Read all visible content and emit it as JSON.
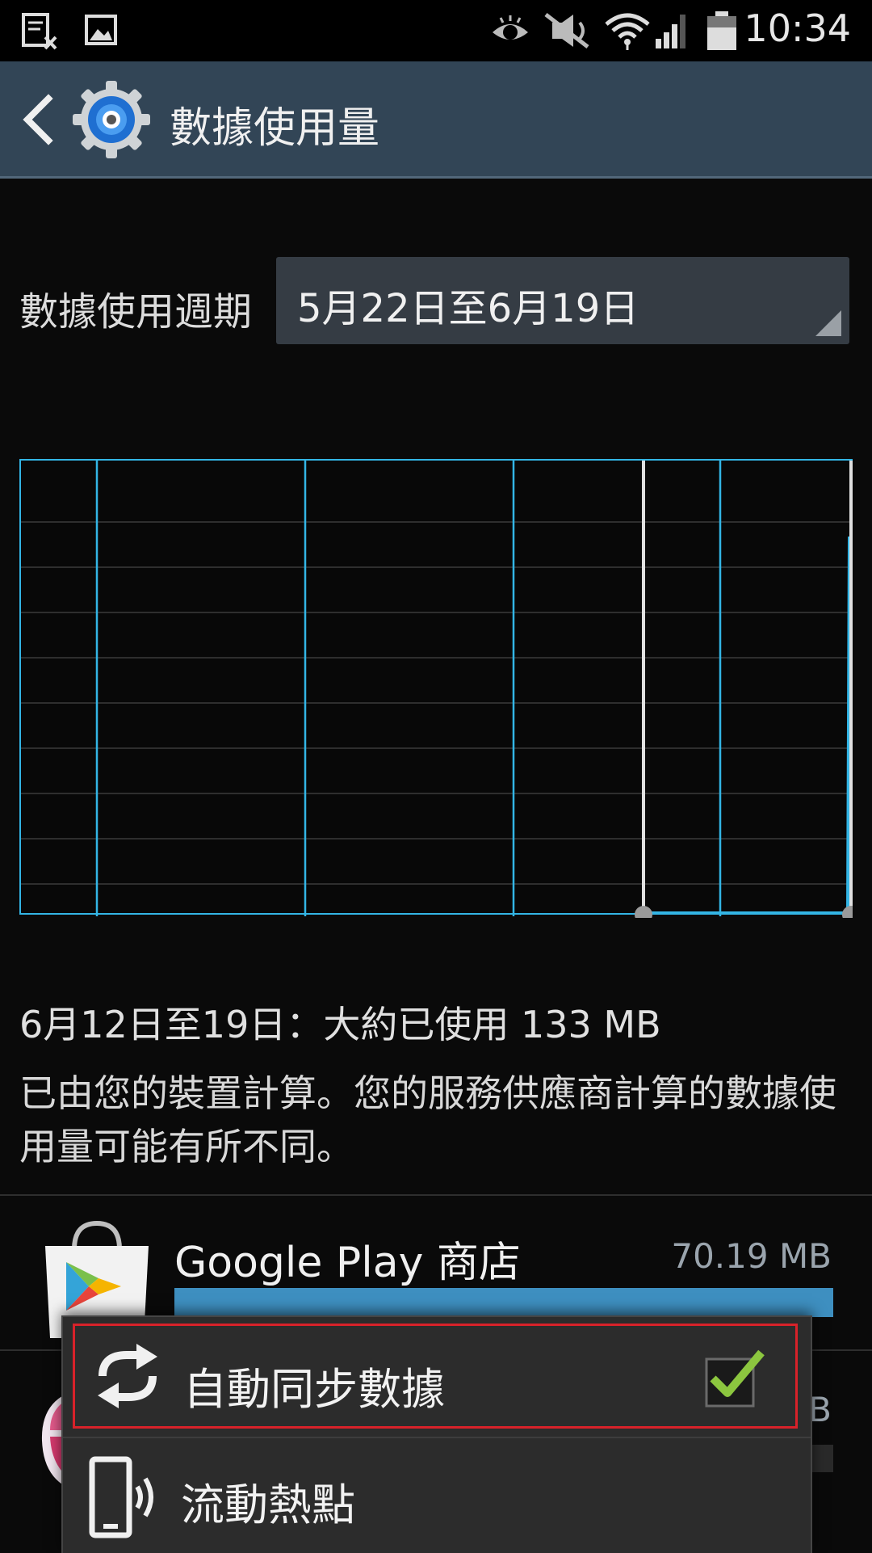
{
  "status_bar": {
    "time": "10:34",
    "icons": [
      "notification-doc-icon",
      "notification-image-icon",
      "smart-stay-eye-icon",
      "mute-icon",
      "wifi-icon",
      "cell-signal-icon",
      "battery-icon"
    ]
  },
  "action_bar": {
    "title": "數據使用量",
    "back_icon": "chevron-left-icon",
    "app_icon": "settings-gear-icon"
  },
  "cycle": {
    "label": "數據使用週期",
    "value": "5月22日至6月19日"
  },
  "chart_data": {
    "type": "area",
    "title": "",
    "xlabel": "",
    "ylabel": "",
    "grid": true,
    "colors": {
      "grid": "#3a3a3a",
      "line": "#33b5e5",
      "handle": "#e0e0e0"
    },
    "selection": {
      "start": "6月12日",
      "end": "6月19日"
    }
  },
  "usage": {
    "summary": "6月12日至19日：大約已使用 133 MB",
    "note": "已由您的裝置計算。您的服務供應商計算的數據使用量可能有所不同。"
  },
  "apps": [
    {
      "name": "Google Play 商店",
      "size": "70.19 MB",
      "usage_fraction": 1.0,
      "icon": "play-store-icon"
    },
    {
      "name": "",
      "size": "B",
      "icon": "app-icon-partial"
    }
  ],
  "menu": {
    "items": [
      {
        "label": "自動同步數據",
        "icon": "sync-icon",
        "checked": true
      },
      {
        "label": "流動熱點",
        "icon": "mobile-hotspot-icon"
      }
    ]
  },
  "colors": {
    "action_bar": "#324556",
    "accent": "#33b5e5",
    "check": "#8cc63f",
    "highlight_border": "#d8222a"
  }
}
